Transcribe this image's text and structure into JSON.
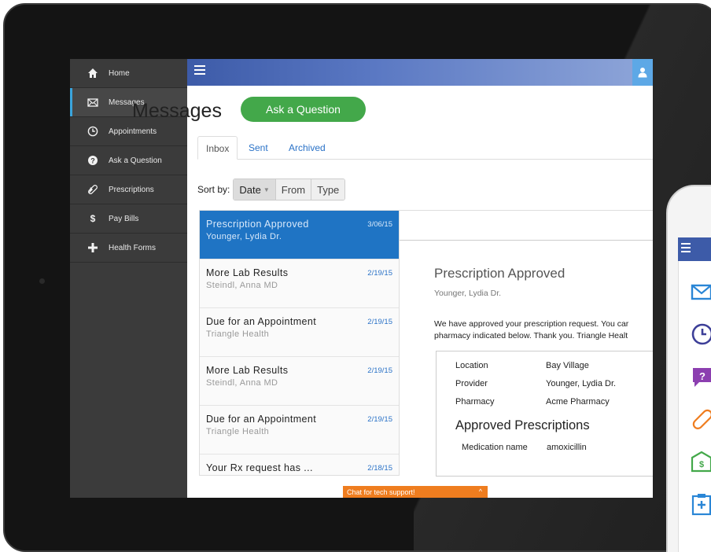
{
  "sidebar": {
    "items": [
      {
        "label": "Home",
        "icon": "home-icon"
      },
      {
        "label": "Messages",
        "icon": "envelope-icon",
        "active": true
      },
      {
        "label": "Appointments",
        "icon": "clock-icon"
      },
      {
        "label": "Ask a Question",
        "icon": "question-icon"
      },
      {
        "label": "Prescriptions",
        "icon": "pill-icon"
      },
      {
        "label": "Pay Bills",
        "icon": "dollar-icon"
      },
      {
        "label": "Health Forms",
        "icon": "plus-icon"
      }
    ]
  },
  "header": {
    "title": "Messages",
    "ask_button": "Ask a Question"
  },
  "tabs": [
    {
      "label": "Inbox",
      "active": true
    },
    {
      "label": "Sent"
    },
    {
      "label": "Archived"
    }
  ],
  "sort": {
    "label": "Sort by:",
    "options": [
      "Date",
      "From",
      "Type"
    ],
    "selected": "Date"
  },
  "messages": [
    {
      "title": "Prescription Approved",
      "from": "Younger, Lydia Dr.",
      "date": "3/06/15",
      "selected": true
    },
    {
      "title": "More Lab Results",
      "from": "Steindl, Anna MD",
      "date": "2/19/15"
    },
    {
      "title": "Due for an Appointment",
      "from": "Triangle Health",
      "date": "2/19/15"
    },
    {
      "title": "More Lab Results",
      "from": "Steindl, Anna MD",
      "date": "2/19/15"
    },
    {
      "title": "Due for an Appointment",
      "from": "Triangle Health",
      "date": "2/19/15"
    },
    {
      "title": "Your Rx request has ...",
      "from": "",
      "date": "2/18/15"
    }
  ],
  "detail": {
    "subject": "Prescription Approved",
    "from": "Younger, Lydia Dr.",
    "body_line1": "We have approved your prescription request. You car",
    "body_line2": "pharmacy indicated below. Thank you. Triangle Healt",
    "info": [
      {
        "key": "Location",
        "value": "Bay Village"
      },
      {
        "key": "Provider",
        "value": "Younger, Lydia Dr."
      },
      {
        "key": "Pharmacy",
        "value": "Acme Pharmacy"
      }
    ],
    "rx_title": "Approved Prescriptions",
    "rx_key": "Medication name",
    "rx_value": "amoxicillin"
  },
  "chat": {
    "label": "Chat for tech support!",
    "chevron": "^"
  },
  "colors": {
    "sidebar": "#3b3b3b",
    "topbar": "#3d5ba8",
    "ask_button": "#43a84a",
    "selected_message": "#1f74c4",
    "link": "#2a72c7",
    "chat_bar": "#ef7d1f"
  },
  "phone_icons": [
    "envelope-icon",
    "clock-icon",
    "question-icon",
    "pill-icon",
    "bill-icon",
    "clipboard-icon"
  ]
}
